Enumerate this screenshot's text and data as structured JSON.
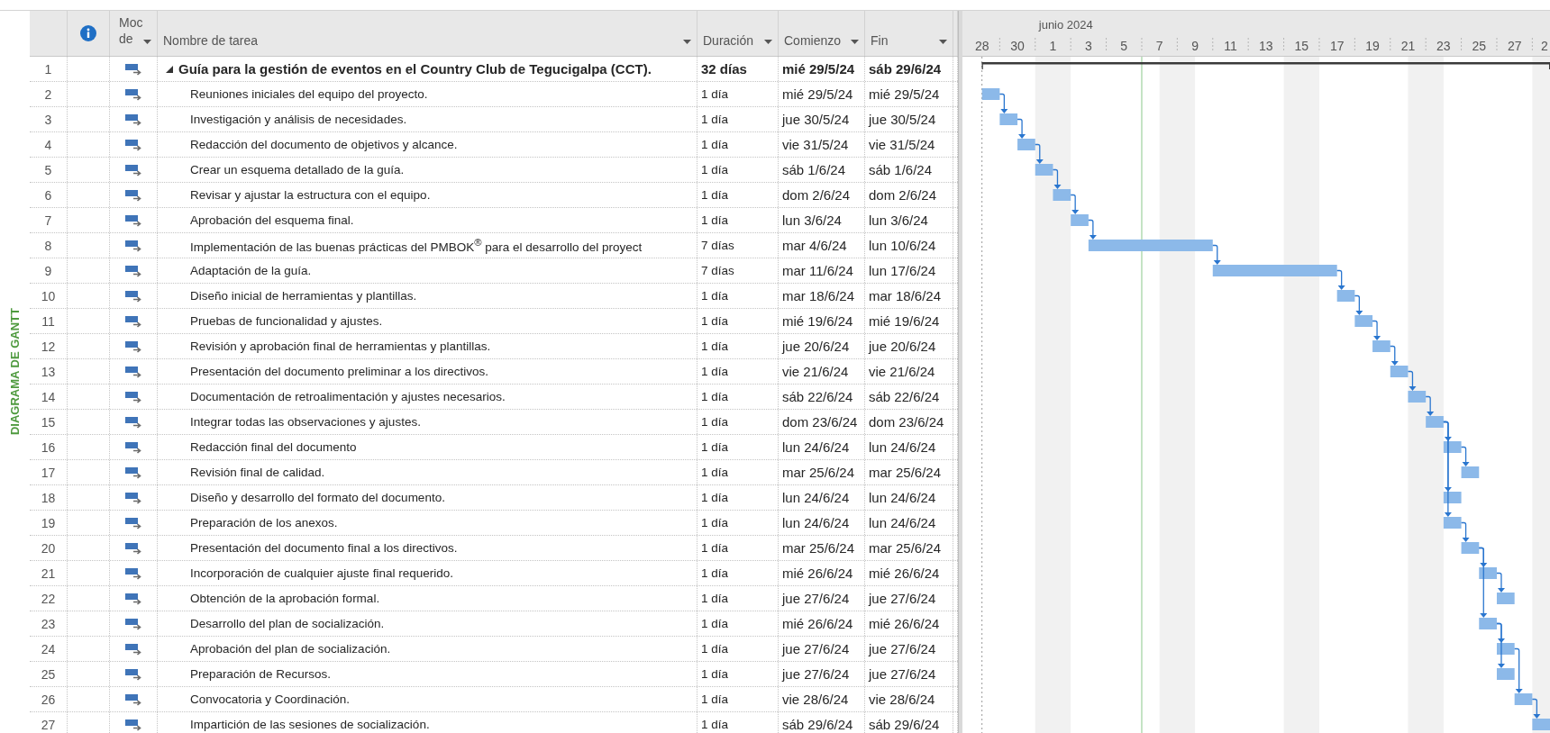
{
  "view_label": "DIAGRAMA DE GANTT",
  "columns": {
    "mode": [
      "Moc",
      "de"
    ],
    "name": "Nombre de tarea",
    "duration": "Duración",
    "start": "Comienzo",
    "finish": "Fin"
  },
  "tasks": [
    {
      "id": "1",
      "kind": "summary",
      "expanded": true,
      "name": "Guía para la gestión de eventos en el Country Club de Tegucigalpa (CCT).",
      "duration": "32 días",
      "start": "mié 29/5/24",
      "finish": "sáb 29/6/24"
    },
    {
      "id": "2",
      "kind": "task",
      "name": "Reuniones iniciales del equipo del proyecto.",
      "duration": "1 día",
      "start": "mié 29/5/24",
      "finish": "mié 29/5/24"
    },
    {
      "id": "3",
      "kind": "task",
      "name": "Investigación y análisis de necesidades.",
      "duration": "1 día",
      "start": "jue 30/5/24",
      "finish": "jue 30/5/24"
    },
    {
      "id": "4",
      "kind": "task",
      "name": "Redacción del documento de objetivos y alcance.",
      "duration": "1 día",
      "start": "vie 31/5/24",
      "finish": "vie 31/5/24"
    },
    {
      "id": "5",
      "kind": "task",
      "name": "Crear un esquema detallado de la guía.",
      "duration": "1 día",
      "start": "sáb 1/6/24",
      "finish": "sáb 1/6/24"
    },
    {
      "id": "6",
      "kind": "task",
      "name": "Revisar y ajustar la estructura con el equipo.",
      "duration": "1 día",
      "start": "dom 2/6/24",
      "finish": "dom 2/6/24"
    },
    {
      "id": "7",
      "kind": "task",
      "name": "Aprobación del esquema final.",
      "duration": "1 día",
      "start": "lun 3/6/24",
      "finish": "lun 3/6/24"
    },
    {
      "id": "8",
      "kind": "task",
      "name": "Implementación de las buenas prácticas del PMBOK$^{®}$ para el desarrollo del proyect",
      "duration": "7 días",
      "start": "mar 4/6/24",
      "finish": "lun 10/6/24"
    },
    {
      "id": "9",
      "kind": "task",
      "name": "Adaptación de la guía.",
      "duration": "7 días",
      "start": "mar 11/6/24",
      "finish": "lun 17/6/24"
    },
    {
      "id": "10",
      "kind": "task",
      "name": "Diseño inicial de herramientas y plantillas.",
      "duration": "1 día",
      "start": "mar 18/6/24",
      "finish": "mar 18/6/24"
    },
    {
      "id": "11",
      "kind": "task",
      "name": "Pruebas de funcionalidad y ajustes.",
      "duration": "1 día",
      "start": "mié 19/6/24",
      "finish": "mié 19/6/24"
    },
    {
      "id": "12",
      "kind": "task",
      "name": "Revisión y aprobación final de herramientas y plantillas.",
      "duration": "1 día",
      "start": "jue 20/6/24",
      "finish": "jue 20/6/24"
    },
    {
      "id": "13",
      "kind": "task",
      "name": "Presentación del documento preliminar a los directivos.",
      "duration": "1 día",
      "start": "vie 21/6/24",
      "finish": "vie 21/6/24"
    },
    {
      "id": "14",
      "kind": "task",
      "name": "Documentación de retroalimentación y ajustes necesarios.",
      "duration": "1 día",
      "start": "sáb 22/6/24",
      "finish": "sáb 22/6/24"
    },
    {
      "id": "15",
      "kind": "task",
      "name": "Integrar todas las observaciones y ajustes.",
      "duration": "1 día",
      "start": "dom 23/6/24",
      "finish": "dom 23/6/24"
    },
    {
      "id": "16",
      "kind": "task",
      "name": "Redacción final del documento",
      "duration": "1 día",
      "start": "lun 24/6/24",
      "finish": "lun 24/6/24"
    },
    {
      "id": "17",
      "kind": "task",
      "name": "Revisión final de calidad.",
      "duration": "1 día",
      "start": "mar 25/6/24",
      "finish": "mar 25/6/24"
    },
    {
      "id": "18",
      "kind": "task",
      "name": "Diseño y desarrollo del formato del documento.",
      "duration": "1 día",
      "start": "lun 24/6/24",
      "finish": "lun 24/6/24"
    },
    {
      "id": "19",
      "kind": "task",
      "name": "Preparación de los anexos.",
      "duration": "1 día",
      "start": "lun 24/6/24",
      "finish": "lun 24/6/24"
    },
    {
      "id": "20",
      "kind": "task",
      "name": "Presentación del documento final a los directivos.",
      "duration": "1 día",
      "start": "mar 25/6/24",
      "finish": "mar 25/6/24"
    },
    {
      "id": "21",
      "kind": "task",
      "name": "Incorporación de cualquier ajuste final requerido.",
      "duration": "1 día",
      "start": "mié 26/6/24",
      "finish": "mié 26/6/24"
    },
    {
      "id": "22",
      "kind": "task",
      "name": "Obtención de la aprobación formal.",
      "duration": "1 día",
      "start": "jue 27/6/24",
      "finish": "jue 27/6/24"
    },
    {
      "id": "23",
      "kind": "task",
      "name": "Desarrollo del plan de socialización.",
      "duration": "1 día",
      "start": "mié 26/6/24",
      "finish": "mié 26/6/24"
    },
    {
      "id": "24",
      "kind": "task",
      "name": "Aprobación del plan de socialización.",
      "duration": "1 día",
      "start": "jue 27/6/24",
      "finish": "jue 27/6/24"
    },
    {
      "id": "25",
      "kind": "task",
      "name": "Preparación de Recursos.",
      "duration": "1 día",
      "start": "jue 27/6/24",
      "finish": "jue 27/6/24"
    },
    {
      "id": "26",
      "kind": "task",
      "name": "Convocatoria y Coordinación.",
      "duration": "1 día",
      "start": "vie 28/6/24",
      "finish": "vie 28/6/24"
    },
    {
      "id": "27",
      "kind": "task",
      "name": "Impartición de las sesiones de socialización.",
      "duration": "1 día",
      "start": "sáb 29/6/24",
      "finish": "sáb 29/6/24"
    }
  ],
  "timescale": {
    "month": "junio 2024",
    "days": [
      "28",
      "30",
      "1",
      "3",
      "5",
      "7",
      "9",
      "11",
      "13",
      "15",
      "17",
      "19",
      "21",
      "23",
      "25",
      "27",
      "2"
    ]
  }
}
